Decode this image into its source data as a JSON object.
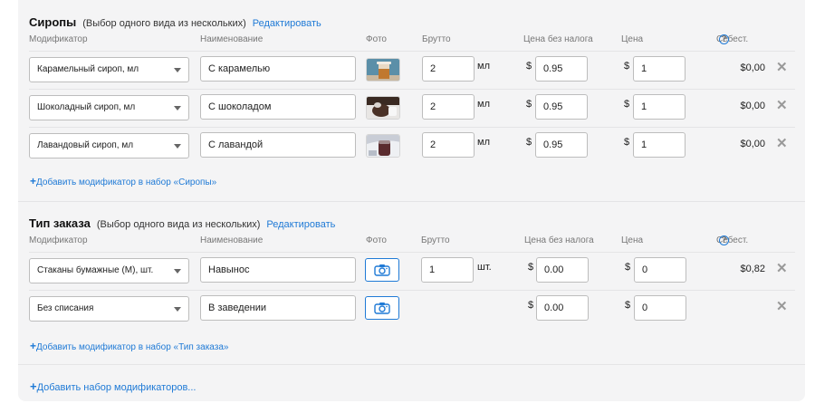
{
  "syrups": {
    "title": "Сиропы",
    "subtitle": "(Выбор одного вида из нескольких)",
    "edit": "Редактировать",
    "columns": {
      "modifier": "Модификатор",
      "name": "Наименование",
      "photo": "Фото",
      "gross": "Брутто",
      "price_no_tax": "Цена без налога",
      "price": "Цена",
      "cost": "Себест."
    },
    "rows": [
      {
        "modifier": "Карамельный сироп, мл",
        "name": "С карамелью",
        "photo": "caramel-drink-photo",
        "gross": "2",
        "unit": "мл",
        "currency": "$",
        "price_no_tax": "0.95",
        "price": "1",
        "cost": "$0,00"
      },
      {
        "modifier": "Шоколадный сироп, мл",
        "name": "С шоколадом",
        "photo": "chocolate-drink-photo",
        "gross": "2",
        "unit": "мл",
        "currency": "$",
        "price_no_tax": "0.95",
        "price": "1",
        "cost": "$0,00"
      },
      {
        "modifier": "Лавандовый сироп, мл",
        "name": "С лавандой",
        "photo": "lavender-drink-photo",
        "gross": "2",
        "unit": "мл",
        "currency": "$",
        "price_no_tax": "0.95",
        "price": "1",
        "cost": "$0,00"
      }
    ],
    "add_modifier": "Добавить модификатор в набор «Сиропы»"
  },
  "order_type": {
    "title": "Тип заказа",
    "subtitle": "(Выбор одного вида из нескольких)",
    "edit": "Редактировать",
    "columns": {
      "modifier": "Модификатор",
      "name": "Наименование",
      "photo": "Фото",
      "gross": "Брутто",
      "price_no_tax": "Цена без налога",
      "price": "Цена",
      "cost": "Себест."
    },
    "rows": [
      {
        "modifier": "Стаканы бумажные (М), шт.",
        "name": "Навынос",
        "photo": "camera-icon",
        "gross": "1",
        "unit": "шт.",
        "currency": "$",
        "price_no_tax": "0.00",
        "price": "0",
        "cost": "$0,82"
      },
      {
        "modifier": "Без списания",
        "name": "В заведении",
        "photo": "camera-icon",
        "gross": "",
        "unit": "",
        "currency": "$",
        "price_no_tax": "0.00",
        "price": "0",
        "cost": ""
      }
    ],
    "add_modifier": "Добавить модификатор в набор «Тип заказа»"
  },
  "add_set": "Добавить набор модификаторов...",
  "plus_sign": "+",
  "help_mark": "?",
  "remove_mark": "✕",
  "colors": {
    "accent": "#1f7ad6",
    "panel": "#f4f4f5",
    "border": "#bdbdbd"
  }
}
